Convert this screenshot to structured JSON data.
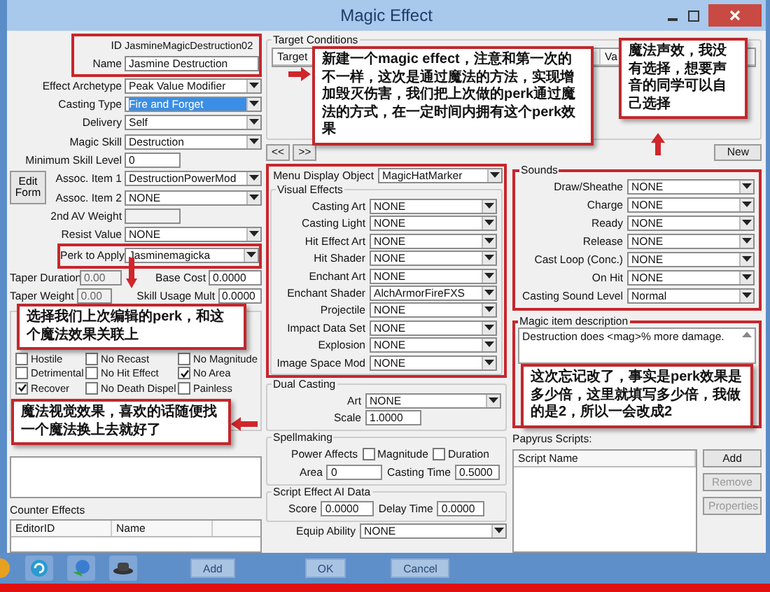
{
  "window": {
    "title": "Magic Effect"
  },
  "left": {
    "fields": [
      {
        "label": "ID",
        "kind": "text",
        "value": "JasmineMagicDestruction02",
        "selected": false
      },
      {
        "label": "Name",
        "kind": "input",
        "value": "Jasmine Destruction",
        "selected": false
      },
      {
        "label": "Effect Archetype",
        "kind": "dropdown",
        "value": "Peak Value Modifier",
        "selected": false
      },
      {
        "label": "Casting Type",
        "kind": "dropdown",
        "value": "Fire and Forget",
        "selected": true
      },
      {
        "label": "Delivery",
        "kind": "dropdown",
        "value": "Self",
        "selected": false
      },
      {
        "label": "Magic Skill",
        "kind": "dropdown",
        "value": "Destruction",
        "selected": false
      },
      {
        "label": "Minimum Skill Level",
        "kind": "short",
        "value": "0",
        "selected": false
      },
      {
        "label": "Assoc. Item 1",
        "kind": "dropdown",
        "value": "DestructionPowerMod",
        "selected": false
      },
      {
        "label": "Assoc. Item 2",
        "kind": "dropdown",
        "value": "NONE",
        "selected": false
      },
      {
        "label": "2nd AV Weight",
        "kind": "short_disabled",
        "selected": false
      },
      {
        "label": "Resist Value",
        "kind": "dropdown",
        "value": "NONE",
        "selected": false
      },
      {
        "label": "Perk to Apply",
        "kind": "dropdown",
        "value": "Jasminemagicka",
        "selected": false
      }
    ],
    "edit_form_button": "Edit Form",
    "pairs": [
      {
        "label": "Taper Duration",
        "value": "0.00",
        "label2": "Base Cost",
        "value2": "0.0000"
      },
      {
        "label": "Taper Weight",
        "value": "0.00",
        "label2": "Skill Usage Mult",
        "value2": "0.0000"
      }
    ],
    "flags": [
      {
        "label": "Hostile",
        "checked": false
      },
      {
        "label": "No Recast",
        "checked": false
      },
      {
        "label": "No Magnitude",
        "checked": false
      },
      {
        "label": "Detrimental",
        "checked": false
      },
      {
        "label": "No Hit Effect",
        "checked": false
      },
      {
        "label": "No Area",
        "checked": true
      },
      {
        "label": "Recover",
        "checked": true
      },
      {
        "label": "No Death Dispel",
        "checked": false
      },
      {
        "label": "Painless",
        "checked": false
      }
    ],
    "counter_effects": {
      "title": "Counter Effects",
      "columns": [
        "EditorID",
        "Name"
      ]
    }
  },
  "target_conditions": {
    "title": "Target Conditions",
    "columns": [
      "Target",
      "Va"
    ]
  },
  "nav_buttons": [
    "<<",
    ">>"
  ],
  "new_button": "New",
  "middle": {
    "menu_display": {
      "label": "Menu Display Object",
      "value": "MagicHatMarker"
    },
    "visual_effects": {
      "title": "Visual Effects",
      "items": [
        {
          "label": "Casting Art",
          "value": "NONE"
        },
        {
          "label": "Casting Light",
          "value": "NONE"
        },
        {
          "label": "Hit Effect Art",
          "value": "NONE"
        },
        {
          "label": "Hit Shader",
          "value": "NONE"
        },
        {
          "label": "Enchant Art",
          "value": "NONE"
        },
        {
          "label": "Enchant Shader",
          "value": "AlchArmorFireFXS"
        },
        {
          "label": "Projectile",
          "value": "NONE"
        },
        {
          "label": "Impact Data Set",
          "value": "NONE"
        },
        {
          "label": "Explosion",
          "value": "NONE"
        },
        {
          "label": "Image Space Mod",
          "value": "NONE"
        }
      ]
    },
    "dual_casting": {
      "title": "Dual Casting",
      "art": {
        "label": "Art",
        "value": "NONE"
      },
      "scale": {
        "label": "Scale",
        "value": "1.0000"
      }
    },
    "spellmaking": {
      "title": "Spellmaking",
      "power_label": "Power Affects",
      "options": [
        {
          "label": "Magnitude",
          "checked": false
        },
        {
          "label": "Duration",
          "checked": false
        }
      ],
      "area": {
        "label": "Area",
        "value": "0"
      },
      "casting_time": {
        "label": "Casting Time",
        "value": "0.5000"
      }
    },
    "script_ai": {
      "title": "Script Effect AI Data",
      "score": {
        "label": "Score",
        "value": "0.0000"
      },
      "delay": {
        "label": "Delay Time",
        "value": "0.0000"
      }
    },
    "equip_ability": {
      "label": "Equip Ability",
      "value": "NONE"
    }
  },
  "right": {
    "sounds": {
      "title": "Sounds",
      "items": [
        {
          "label": "Draw/Sheathe",
          "value": "NONE"
        },
        {
          "label": "Charge",
          "value": "NONE"
        },
        {
          "label": "Ready",
          "value": "NONE"
        },
        {
          "label": "Release",
          "value": "NONE"
        },
        {
          "label": "Cast Loop (Conc.)",
          "value": "NONE"
        },
        {
          "label": "On Hit",
          "value": "NONE"
        },
        {
          "label": "Casting Sound Level",
          "value": "Normal"
        }
      ]
    },
    "description": {
      "title": "Magic item description",
      "text": "Destruction does <mag>% more damage."
    },
    "papyrus": {
      "title": "Papyrus Scripts:",
      "column": "Script Name",
      "buttons": [
        {
          "label": "Add",
          "disabled": false
        },
        {
          "label": "Remove",
          "disabled": true
        },
        {
          "label": "Properties",
          "disabled": true
        }
      ]
    }
  },
  "bottom_buttons": [
    "Add",
    "OK",
    "Cancel"
  ],
  "annotations": [
    {
      "text": "新建一个magic effect，注意和第一次的不一样，这次是通过魔法的方法，实现增加毁灭伤害，我们把上次做的perk通过魔法的方式，在一定时间内拥有这个perk效果"
    },
    {
      "text": "魔法声效，我没有选择，想要声音的同学可以自己选择"
    },
    {
      "text": "选择我们上次编辑的perk，和这个魔法效果关联上"
    },
    {
      "text": "魔法视觉效果，喜欢的话随便找一个魔法换上去就好了"
    },
    {
      "text": "这次忘记改了，事实是perk效果是多少倍，这里就填写多少倍，我做的是2，所以一会改成2"
    }
  ]
}
